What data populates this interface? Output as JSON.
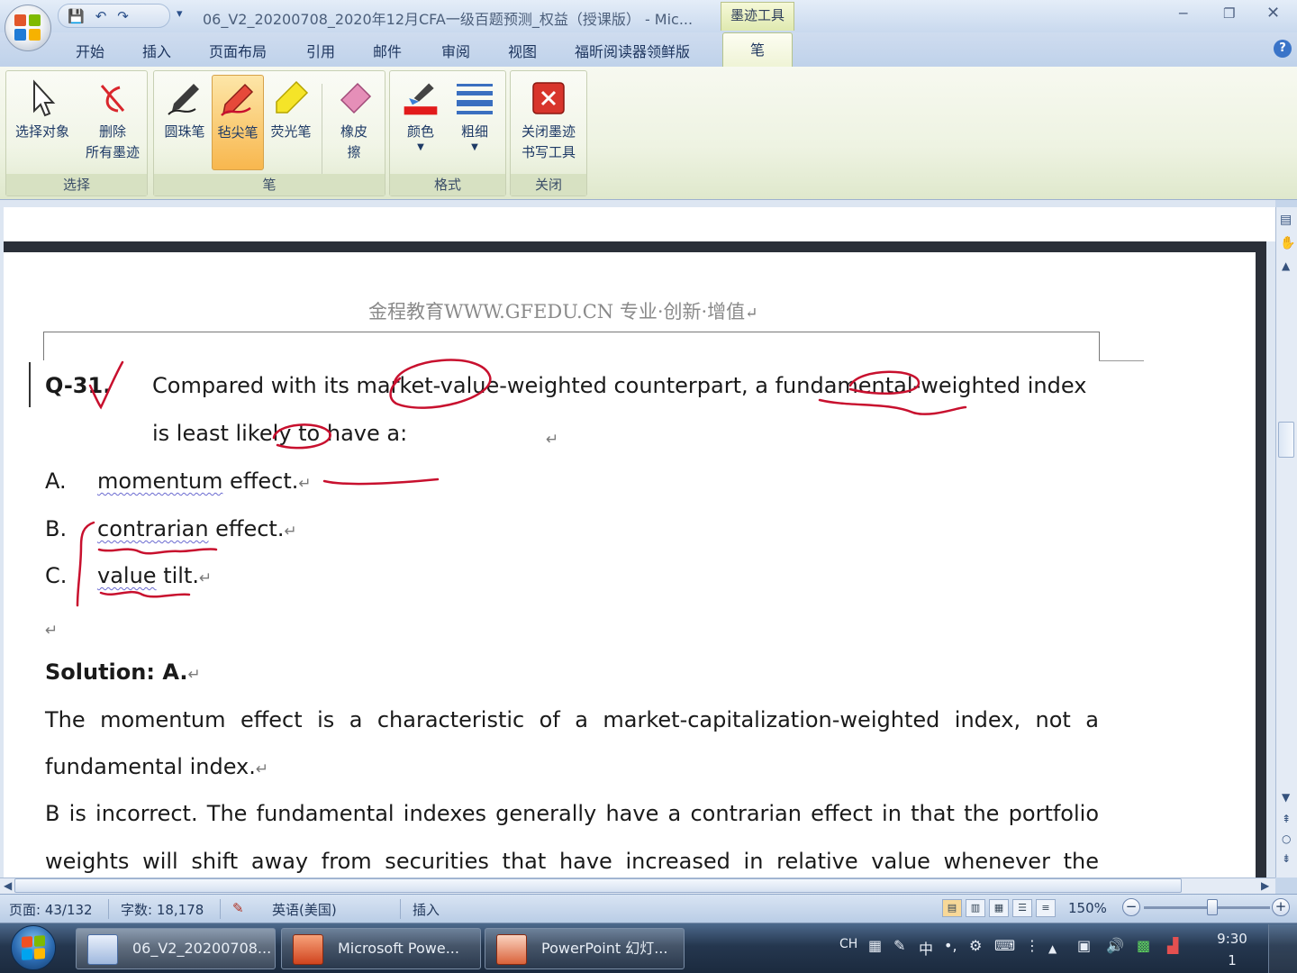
{
  "title_bar": {
    "title": "06_V2_20200708_2020年12月CFA一级百题预测_权益（授课版） - Mic...",
    "contextual_tab": "墨迹工具",
    "minimize": "‒",
    "restore": "❐",
    "close": "✕"
  },
  "ribbon_tabs": [
    "开始",
    "插入",
    "页面布局",
    "引用",
    "邮件",
    "审阅",
    "视图",
    "福昕阅读器领鲜版",
    "笔"
  ],
  "ribbon": {
    "groups": {
      "select": "选择",
      "pen": "笔",
      "format": "格式",
      "close": "关闭"
    },
    "buttons": {
      "select_object": "选择对象",
      "delete_line1": "删除",
      "delete_line2": "所有墨迹",
      "ballpoint": "圆珠笔",
      "felt_tip": "毡尖笔",
      "highlighter": "荧光笔",
      "eraser_line1": "橡皮",
      "eraser_line2": "擦",
      "color": "颜色",
      "thickness": "粗细",
      "close_line1": "关闭墨迹",
      "close_line2": "书写工具"
    }
  },
  "document": {
    "header": "金程教育WWW.GFEDU.CN 专业·创新·增值",
    "question_no": "Q-31.",
    "question_line1": "Compared with its market-value-weighted counterpart, a fundamental-weighted index",
    "question_line2": "is least likely to have a:",
    "options": [
      {
        "letter": "A.",
        "text_sq": "momentum",
        "text_rest": " effect."
      },
      {
        "letter": "B.",
        "text_sq": "contrarian",
        "text_rest": " effect."
      },
      {
        "letter": "C.",
        "text_sq": "value",
        "text_rest": " tilt."
      }
    ],
    "solution_label": "Solution: A.",
    "para1_line1": "The momentum effect is a characteristic of a market-capitalization-weighted index, not a",
    "para1_line2": "fundamental index.",
    "para2_line1": "B is incorrect. The fundamental indexes generally have a contrarian effect in that the portfolio",
    "para2_line2": "weights will shift away from securities that have increased in relative value whenever the",
    "para_mark": "↵"
  },
  "status_bar": {
    "page": "页面: 43/132",
    "words": "字数: 18,178",
    "language": "英语(美国)",
    "mode": "插入",
    "zoom": "150%",
    "zoom_out": "−",
    "zoom_in": "+"
  },
  "taskbar": {
    "items": [
      {
        "label": "06_V2_20200708..."
      },
      {
        "label": "Microsoft Powe..."
      },
      {
        "label": "PowerPoint 幻灯..."
      }
    ],
    "tray_lang": "CH",
    "tray_ime": "中",
    "clock_time": "9:30",
    "clock_extra": "1"
  },
  "colors": {
    "ink_red": "#c8102e",
    "ribbon_active": "#f8b74e",
    "taskbar": "#25374f"
  }
}
